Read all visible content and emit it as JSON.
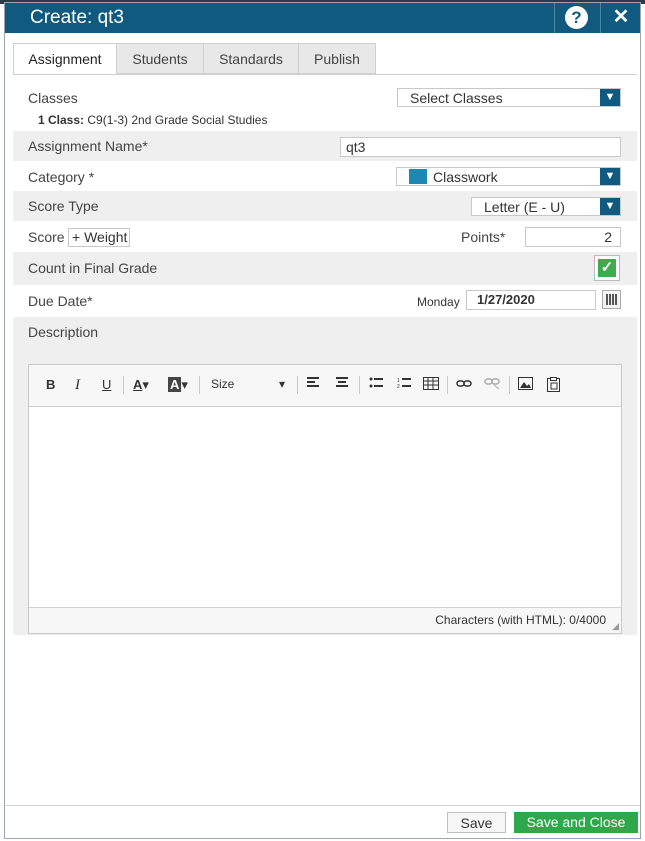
{
  "dialog": {
    "title": "Create: qt3",
    "help_label": "?",
    "close_label": "✕"
  },
  "tabs": [
    {
      "label": "Assignment",
      "active": true
    },
    {
      "label": "Students",
      "active": false
    },
    {
      "label": "Standards",
      "active": false
    },
    {
      "label": "Publish",
      "active": false
    }
  ],
  "form": {
    "classes_label": "Classes",
    "classes_select": "Select Classes",
    "classes_count": "1 Class:",
    "classes_detail": "C9(1-3) 2nd Grade Social Studies",
    "assignment_name_label": "Assignment Name*",
    "assignment_name_value": "qt3",
    "category_label": "Category *",
    "category_value": "Classwork",
    "category_color": "#1e88b4",
    "score_type_label": "Score Type",
    "score_type_value": "Letter (E - U)",
    "score_label": "Score",
    "weight_button": "+ Weight",
    "points_label": "Points*",
    "points_value": "2",
    "count_final_label": "Count in Final Grade",
    "count_final_checked": true,
    "due_date_label": "Due Date*",
    "due_weekday": "Monday",
    "due_date_value": "1/27/2020",
    "description_label": "Description"
  },
  "editor": {
    "tools": [
      "bold-icon",
      "italic-icon",
      "underline-icon",
      "font-color-icon",
      "background-color-icon",
      "size-dropdown",
      "align-left-icon",
      "align-center-icon",
      "bullet-list-icon",
      "numbered-list-icon",
      "table-icon",
      "link-icon",
      "unlink-icon",
      "image-icon",
      "paste-icon"
    ],
    "bold": "B",
    "italic": "I",
    "underline": "U",
    "size_label": "Size",
    "char_count": "Characters (with HTML): 0/4000"
  },
  "footer": {
    "save_label": "Save",
    "save_close_label": "Save and Close"
  },
  "colors": {
    "title_bar": "#0f5a7e",
    "primary_button": "#2fa84c",
    "checkbox": "#3faa4e"
  }
}
